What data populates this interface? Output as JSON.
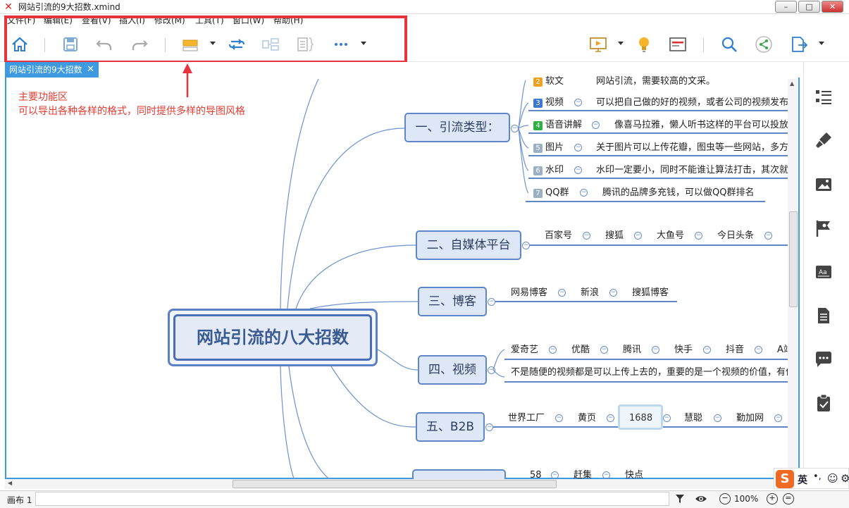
{
  "window": {
    "title": "网站引流的9大招数.xmind",
    "controls": [
      "minimize",
      "maximize",
      "close"
    ]
  },
  "menu": [
    "文件(F)",
    "编辑(E)",
    "查看(V)",
    "插入(I)",
    "修改(M)",
    "工具(T)",
    "窗口(W)",
    "帮助(H)"
  ],
  "toolbar": {
    "icons": [
      "home-icon",
      "save-icon",
      "undo-icon",
      "redo-icon",
      "topic-style-icon",
      "relationship-icon",
      "summary-icon",
      "boundary-icon",
      "more-icon",
      "presentation-icon",
      "idea-icon",
      "outline-icon",
      "search-icon",
      "share-icon",
      "export-icon"
    ]
  },
  "tab": {
    "label": "网站引流的9大招数",
    "close": "✕"
  },
  "annotation": {
    "line1": "主要功能区",
    "line2": "可以导出各种各样的格式，同时提供多样的导图风格"
  },
  "mindmap": {
    "central": "网站引流的八大招数",
    "branch1": {
      "label": "一、引流类型：",
      "items": [
        {
          "num": "2",
          "label": "软文",
          "desc": "网站引流，需要较高的文采。",
          "color": "#f0a020"
        },
        {
          "num": "3",
          "label": "视频",
          "desc": "可以把自己做的好的视频，或者公司的视频发布",
          "color": "#3a78d4"
        },
        {
          "num": "4",
          "label": "语音讲解",
          "desc": "像喜马拉雅，懒人听书这样的平台可以投放",
          "color": "#2db040"
        },
        {
          "num": "5",
          "label": "图片",
          "desc": "关于图片可以上传花瓣，图虫等一些网站，多方",
          "color": "#9bb0c4"
        },
        {
          "num": "6",
          "label": "水印",
          "desc": "水印一定要小，同时不能谁让算法打击，其次就",
          "color": "#9bb0c4"
        },
        {
          "num": "7",
          "label": "QQ群",
          "desc": "腾讯的品牌多充钱，可以做QQ群排名",
          "color": "#9bb0c4"
        }
      ]
    },
    "branch2": {
      "label": "二、自媒体平台",
      "items": [
        "百家号",
        "搜狐",
        "大鱼号",
        "今日头条"
      ]
    },
    "branch3": {
      "label": "三、博客",
      "items": [
        "网易博客",
        "新浪",
        "搜狐博客"
      ]
    },
    "branch4": {
      "label": "四、视频",
      "items": [
        "爱奇艺",
        "优酷",
        "腾讯",
        "快手",
        "抖音",
        "A站"
      ],
      "note": "不是随便的视频都是可以上传上去的，重要的是一个视频的价值，有价"
    },
    "branch5": {
      "label": "五、B2B",
      "items": [
        "世界工厂",
        "黄页",
        "1688",
        "慧聪",
        "勤加网"
      ]
    },
    "branch6": {
      "items": [
        "58",
        "赶集",
        "快点"
      ]
    }
  },
  "rightpanel": [
    "outline-panel-icon",
    "format-brush-icon",
    "image-icon",
    "marker-flag-icon",
    "text-style-icon",
    "notes-icon",
    "comment-icon",
    "task-icon"
  ],
  "status": {
    "sheet_label": "画布 1",
    "zoom": "100%"
  },
  "ime": {
    "label": "英"
  }
}
